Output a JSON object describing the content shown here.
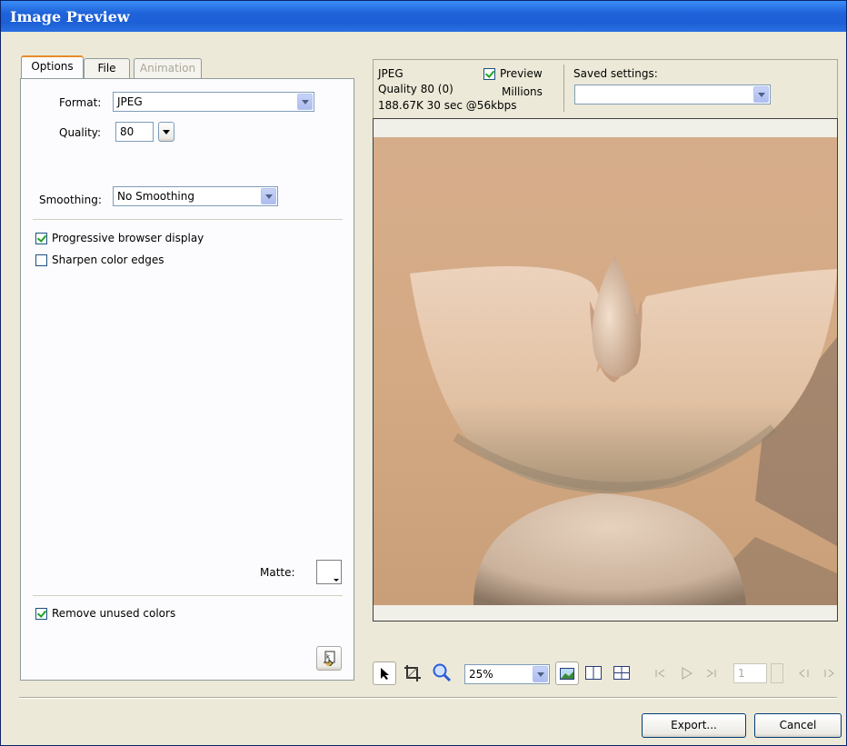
{
  "window": {
    "title": "Image Preview"
  },
  "tabs": [
    {
      "label": "Options"
    },
    {
      "label": "File"
    },
    {
      "label": "Animation"
    }
  ],
  "options": {
    "format_label": "Format:",
    "format_value": "JPEG",
    "quality_label": "Quality:",
    "quality_value": "80",
    "smoothing_label": "Smoothing:",
    "smoothing_value": "No Smoothing",
    "progressive_label": "Progressive browser display",
    "progressive_checked": true,
    "sharpen_label": "Sharpen color edges",
    "sharpen_checked": false,
    "matte_label": "Matte:",
    "remove_unused_label": "Remove unused colors",
    "remove_unused_checked": true
  },
  "info": {
    "format": "JPEG",
    "quality": "Quality 80 (0)",
    "size": "188.67K  30 sec @56kbps",
    "preview_label": "Preview",
    "preview_checked": true,
    "colors": "Millions"
  },
  "saved_settings": {
    "label": "Saved settings:",
    "value": ""
  },
  "toolbar": {
    "zoom_value": "25%",
    "frame_value": "1"
  },
  "buttons": {
    "export": "Export...",
    "cancel": "Cancel"
  },
  "icons": [
    "pointer-icon",
    "crop-icon",
    "zoom-icon",
    "preview-pane-icon",
    "two-pane-icon",
    "four-pane-icon",
    "first-frame-icon",
    "play-icon",
    "last-frame-icon",
    "prev-frame-icon",
    "next-frame-icon",
    "optimize-wizard-icon"
  ]
}
